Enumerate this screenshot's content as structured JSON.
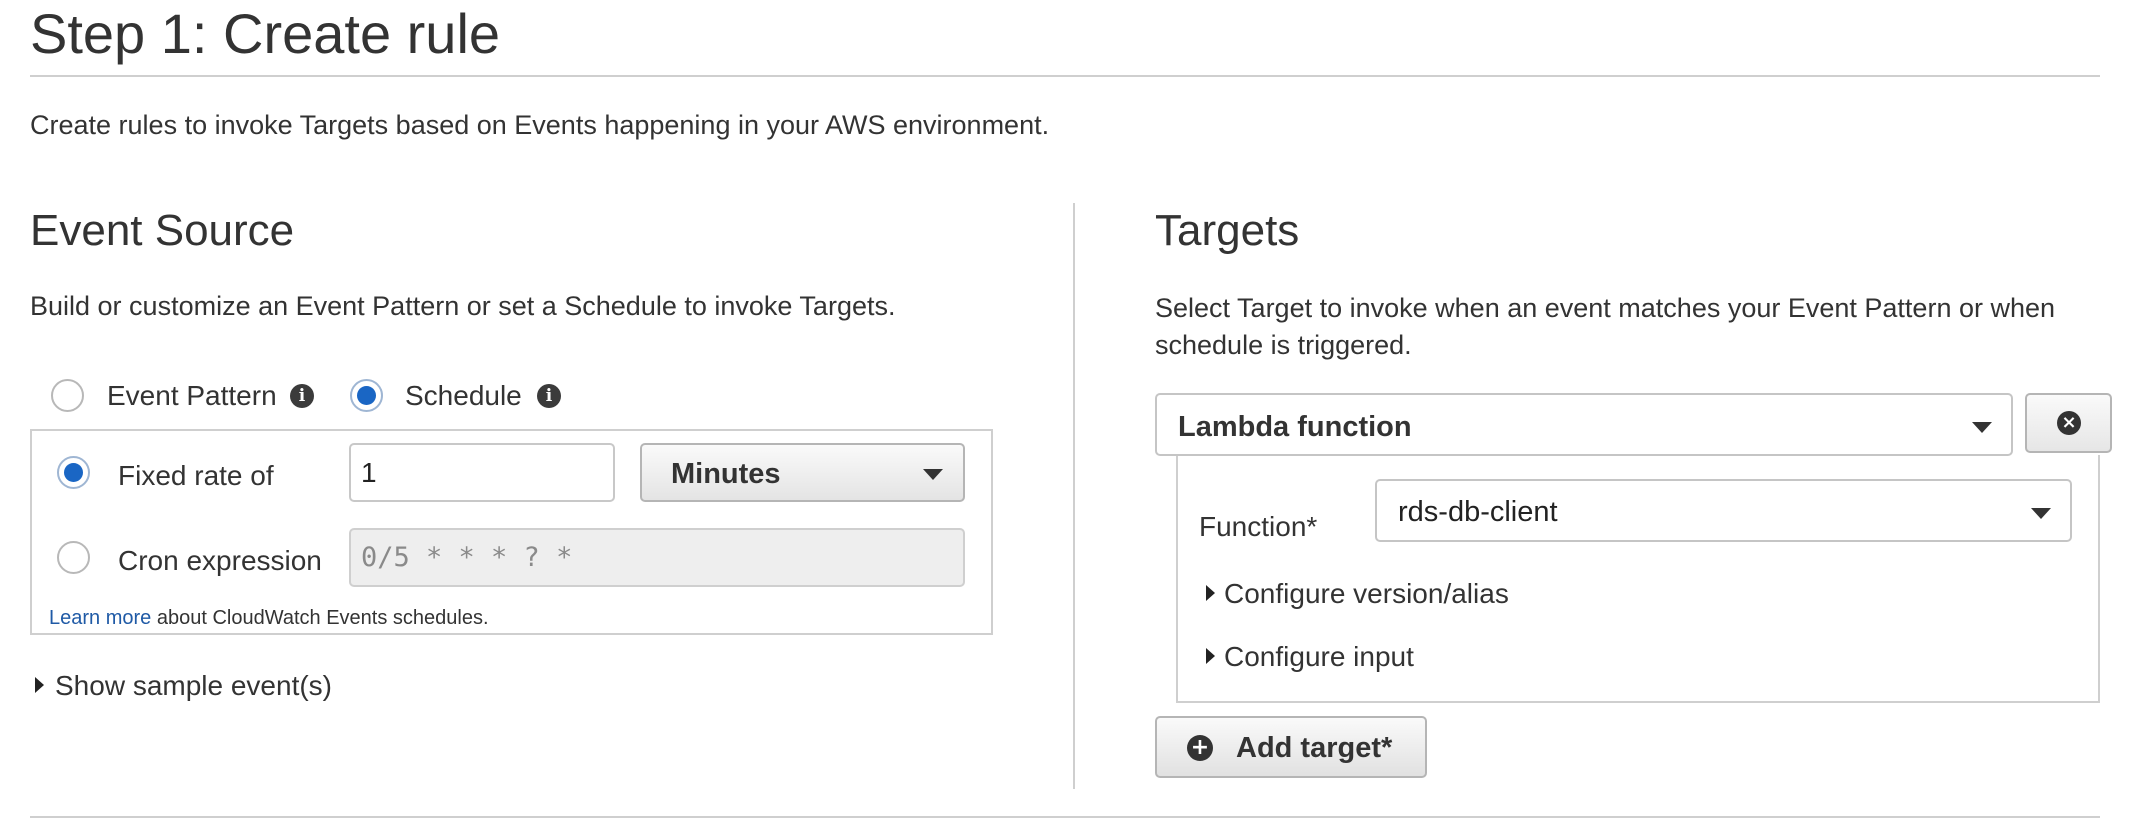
{
  "page": {
    "title": "Step 1: Create rule",
    "intro": "Create rules to invoke Targets based on Events happening in your AWS environment."
  },
  "event_source": {
    "title": "Event Source",
    "description": "Build or customize an Event Pattern or set a Schedule to invoke Targets.",
    "mode_options": [
      {
        "label": "Event Pattern",
        "selected": false
      },
      {
        "label": "Schedule",
        "selected": true
      }
    ],
    "schedule": {
      "fixed_rate_label": "Fixed rate of",
      "fixed_rate_selected": true,
      "fixed_rate_value": "1",
      "unit_selected": "Minutes",
      "cron_label": "Cron expression",
      "cron_selected": false,
      "cron_placeholder": "0/5 * * * ? *",
      "learn_more_link": "Learn more",
      "learn_more_text": "about CloudWatch Events schedules."
    },
    "show_sample": "Show sample event(s)"
  },
  "targets": {
    "title": "Targets",
    "description_line1": "Select Target to invoke when an event matches your Event Pattern or when",
    "description_line2": "schedule is triggered.",
    "target_type": "Lambda function",
    "function_label": "Function*",
    "function_value": "rds-db-client",
    "configure_version": "Configure version/alias",
    "configure_input": "Configure input",
    "add_target": "Add target*"
  },
  "icons": {
    "info": "info-icon",
    "caret": "chevron-down-icon",
    "remove": "close-circle-icon",
    "add": "plus-circle-icon",
    "expand": "triangle-right-icon"
  },
  "colors": {
    "accent_radio": "#1a66c4",
    "link": "#1f5aa6",
    "border": "#cfcfcf",
    "text": "#333333"
  }
}
